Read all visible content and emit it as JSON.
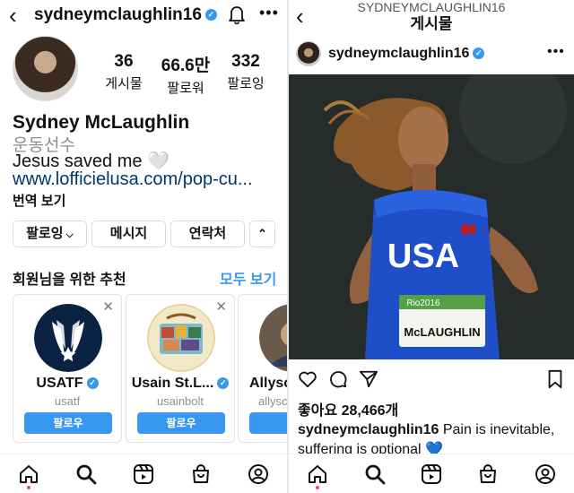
{
  "profile": {
    "username": "sydneymclaughlin16",
    "stats": [
      {
        "num": "36",
        "label": "게시물"
      },
      {
        "num": "66.6만",
        "label": "팔로워"
      },
      {
        "num": "332",
        "label": "팔로잉"
      }
    ],
    "name": "Sydney McLaughlin",
    "category": "운동선수",
    "bio": "Jesus saved me 🤍",
    "link": "www.lofficielusa.com/pop-cu...",
    "translate": "번역 보기",
    "buttons": {
      "following": "팔로잉",
      "message": "메시지",
      "contact": "연락처"
    }
  },
  "recommend": {
    "title": "회원님을 위한 추천",
    "see_all": "모두 보기",
    "cards": [
      {
        "name": "USATF",
        "handle": "usatf",
        "follow": "팔로우"
      },
      {
        "name": "Usain St.L...",
        "handle": "usainbolt",
        "follow": "팔로우"
      },
      {
        "name": "Allysc",
        "handle": "allysc",
        "follow": "팔"
      }
    ]
  },
  "post": {
    "header_handle": "SYDNEYMCLAUGHLIN16",
    "header_title": "게시물",
    "username": "sydneymclaughlin16",
    "bib": "McLAUGHLIN",
    "jersey": "USA",
    "bib_top": "Rio2016",
    "likes": "좋아요 28,466개",
    "caption_user": "sydneymclaughlin16",
    "caption_text": " Pain is inevitable, suffering is optional 💙"
  },
  "colors": {
    "accent": "#3897f0",
    "link": "#00376b",
    "muted": "#8e8e8e",
    "notify_dot": "#ed4956"
  },
  "icons": [
    "back-icon",
    "verified-icon",
    "bell-icon",
    "more-icon",
    "close-icon",
    "chevron-down-icon",
    "chevron-up-icon",
    "heart-icon",
    "comment-icon",
    "share-icon",
    "bookmark-icon",
    "home-icon",
    "search-icon",
    "reels-icon",
    "shop-icon",
    "profile-icon"
  ]
}
